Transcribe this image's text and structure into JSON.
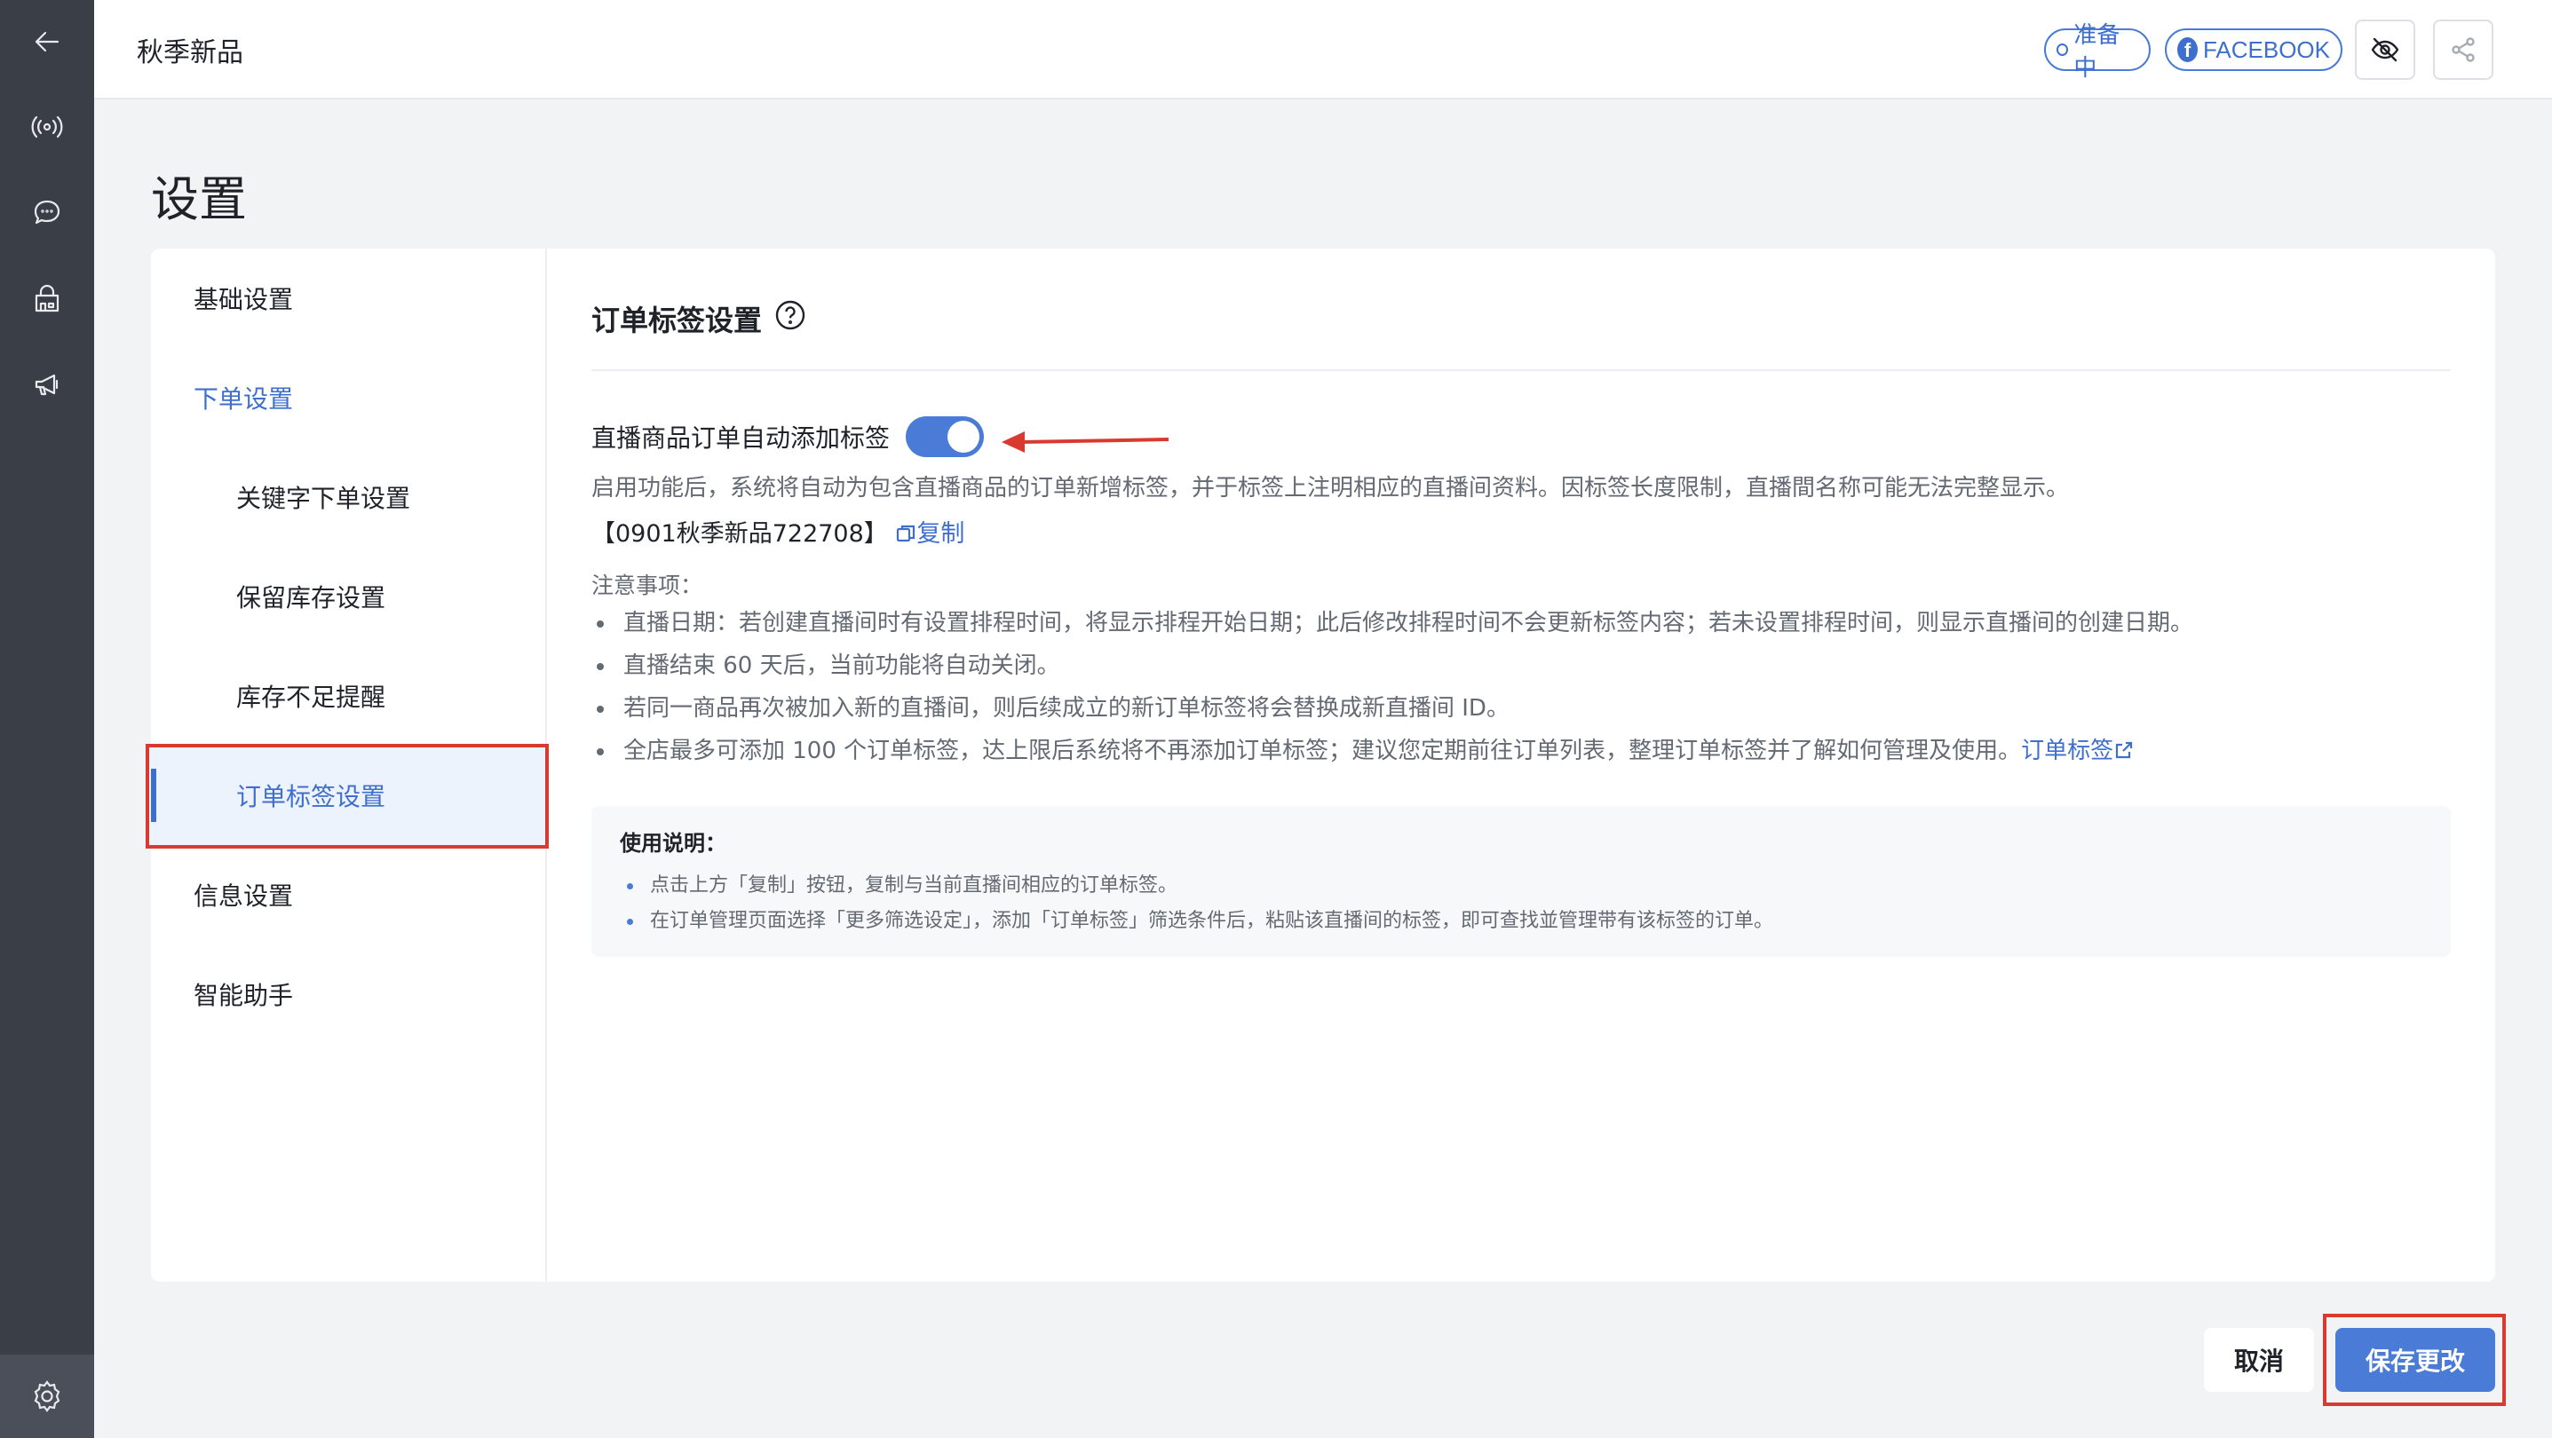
{
  "rail": {
    "icons": [
      "back-arrow-icon",
      "broadcast-icon",
      "chat-icon",
      "store-icon",
      "megaphone-icon"
    ],
    "bottom_icon": "gear-icon"
  },
  "topbar": {
    "title": "秋季新品",
    "status_label": "准备中",
    "platform_label": "FACEBOOK",
    "platform_letter": "f"
  },
  "page": {
    "title": "设置"
  },
  "menu": {
    "items": [
      {
        "label": "基础设置"
      },
      {
        "label": "下单设置"
      },
      {
        "label": "关键字下单设置"
      },
      {
        "label": "保留库存设置"
      },
      {
        "label": "库存不足提醒"
      },
      {
        "label": "订单标签设置"
      },
      {
        "label": "信息设置"
      },
      {
        "label": "智能助手"
      }
    ]
  },
  "content": {
    "section_title": "订单标签设置",
    "toggle_label": "直播商品订单自动添加标签",
    "toggle_on": true,
    "description": "启用功能后，系统将自动为包含直播商品的订单新增标签，并于标签上注明相应的直播间资料。因标签长度限制，直播間名称可能无法完整显示。",
    "tag_value": "【0901秋季新品722708】",
    "copy_label": "复制",
    "notes_title": "注意事项：",
    "notes": [
      "直播日期：若创建直播间时有设置排程时间，将显示排程开始日期；此后修改排程时间不会更新标签内容；若未设置排程时间，则显示直播间的创建日期。",
      "直播结束 60 天后，当前功能将自动关闭。",
      "若同一商品再次被加入新的直播间，则后续成立的新订单标签将会替换成新直播间 ID。",
      "全店最多可添加 100 个订单标签，达上限后系统将不再添加订单标签；建议您定期前往订单列表，整理订单标签并了解如何管理及使用。"
    ],
    "notes_link": "订单标签",
    "usage_title": "使用说明：",
    "usage": [
      "点击上方「复制」按钮，复制与当前直播间相应的订单标签。",
      "在订单管理页面选择「更多筛选设定」，添加「订单标签」筛选条件后，粘贴该直播间的标签，即可查找並管理带有该标签的订单。"
    ]
  },
  "footer": {
    "cancel_label": "取消",
    "save_label": "保存更改"
  },
  "colors": {
    "accent": "#4a7bd6",
    "highlight": "#d93a2f",
    "rail": "#3a3e47"
  }
}
